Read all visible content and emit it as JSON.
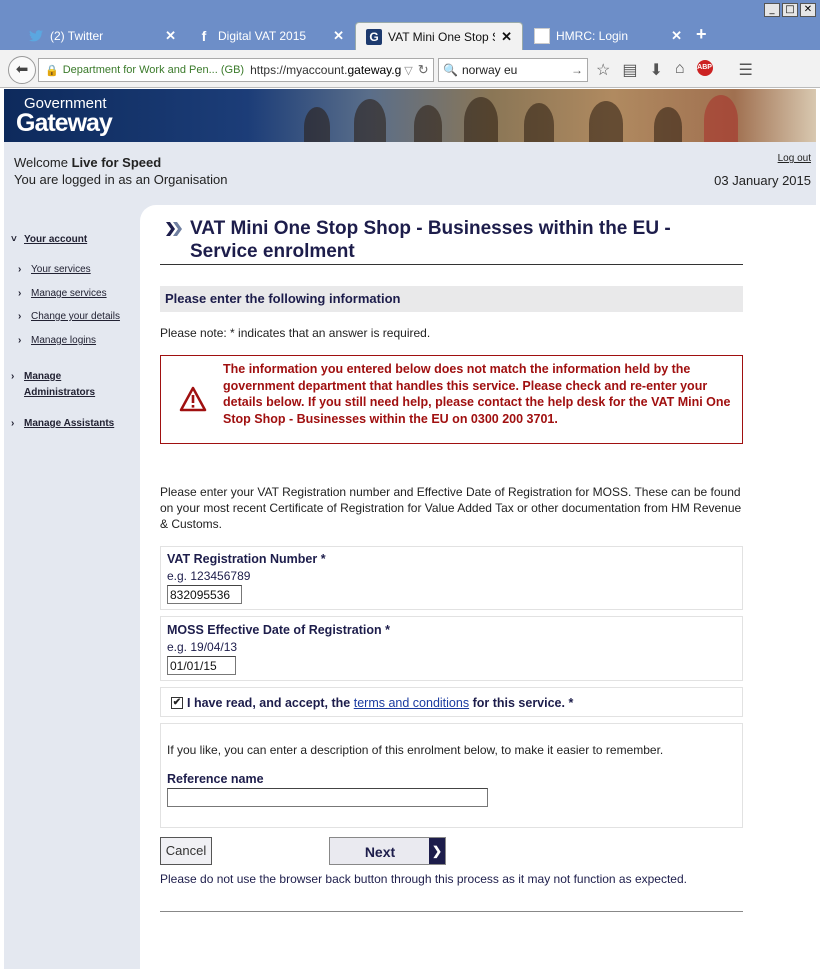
{
  "browser": {
    "tabs": [
      {
        "label": "(2) Twitter",
        "favicon": "twitter-icon"
      },
      {
        "label": "Digital VAT 2015",
        "favicon": "facebook-icon"
      },
      {
        "label": "VAT Mini One Stop S...",
        "favicon": "gateway-icon"
      },
      {
        "label": "HMRC: Login",
        "favicon": "blank-page-icon"
      }
    ],
    "active_tab": 2,
    "identity": "Department for Work and Pen... (GB)",
    "url_prefix": "https://myaccount.",
    "url_domain": "gateway.g",
    "search_value": "norway eu"
  },
  "banner": {
    "logo_line1": "Government",
    "logo_line2": "Gateway"
  },
  "account": {
    "welcome_prefix": "Welcome",
    "user_name": "Live for Speed",
    "logged_in_text": "You are logged in as an Organisation",
    "logout_label": "Log out",
    "date": "03 January 2015"
  },
  "sidebar": {
    "your_account": "Your account",
    "your_services": "Your services",
    "manage_services": "Manage services",
    "change_details": "Change your details",
    "manage_logins": "Manage logins",
    "manage_admins_1": "Manage",
    "manage_admins_2": "Administrators",
    "manage_assistants": "Manage Assistants"
  },
  "main": {
    "title": "VAT Mini One Stop Shop - Businesses within the EU - Service enrolment",
    "section_heading": "Please enter the following information",
    "required_note": "Please note: * indicates that an answer is required.",
    "error_message": "The information you entered below does not match the information held by the government department that handles this service. Please check and re-enter your details below. If you still need help, please contact the help desk for the VAT Mini One Stop Shop - Businesses within the EU on 0300 200 3701.",
    "intro": "Please enter your VAT Registration number and Effective Date of Registration for MOSS. These can be found on your most recent Certificate of Registration for Value Added Tax or other documentation from HM Revenue & Customs.",
    "vat_label": "VAT Registration Number *",
    "vat_hint": "e.g. 123456789",
    "vat_value": "832095536",
    "moss_label": "MOSS Effective Date of Registration *",
    "moss_hint": "e.g. 19/04/13",
    "moss_value": "01/01/15",
    "terms_checked": true,
    "terms_before": "I have read, and accept, the",
    "terms_link": "terms and conditions",
    "terms_after": "for this service. *",
    "description_text": "If you like, you can enter a description of this enrolment below, to make it easier to remember.",
    "reference_label": "Reference name",
    "reference_value": "",
    "cancel_label": "Cancel",
    "next_label": "Next",
    "back_warning": "Please do not use the browser back button through this process as it may not function as expected."
  }
}
